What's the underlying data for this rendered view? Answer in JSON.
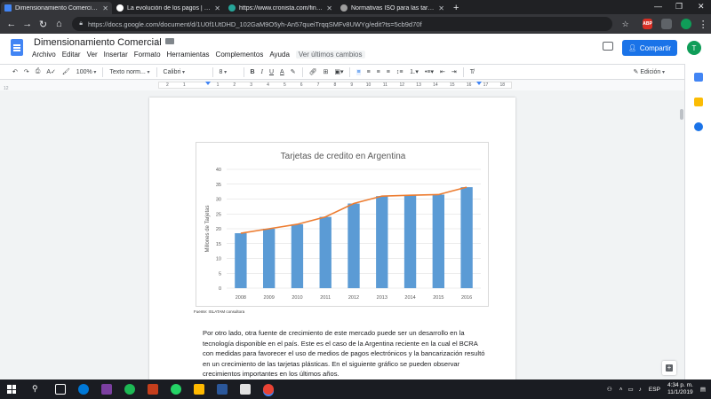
{
  "browser": {
    "tabs": [
      {
        "title": "Dimensionamiento Comercial - G",
        "favicon_color": "#4285f4",
        "active": true
      },
      {
        "title": "La evolución de los pagos | Com",
        "favicon_color": "#ffffff",
        "active": false
      },
      {
        "title": "https://www.cronista.com/finan",
        "favicon_color": "#26a69a",
        "active": false
      },
      {
        "title": "Normativas ISO para las tarjetas",
        "favicon_color": "#9e9e9e",
        "active": false
      }
    ],
    "new_tab": "+",
    "window_controls": {
      "minimize": "—",
      "maximize": "❐",
      "close": "✕"
    },
    "url": "https://docs.google.com/document/d/1U0f1UtDHD_102GaM9O5yh-An57queiTrqqSMFv8UWYg/edit?ts=5cb9d70f"
  },
  "docs": {
    "title": "Dimensionamiento Comercial",
    "menu": [
      "Archivo",
      "Editar",
      "Ver",
      "Insertar",
      "Formato",
      "Herramientas",
      "Complementos",
      "Ayuda"
    ],
    "last_edit": "Ver últimos cambios",
    "share_label": "Compartir",
    "avatar_letter": "T",
    "accent": "#1a73e8"
  },
  "toolbar": {
    "zoom": "100%",
    "style": "Texto norm...",
    "font": "Calibri",
    "size": "8",
    "bold": "B",
    "italic": "I",
    "underline": "U",
    "text_color": "A",
    "mode": "Edición"
  },
  "ruler": {
    "numbers": [
      "2",
      "1",
      "",
      "1",
      "2",
      "3",
      "4",
      "5",
      "6",
      "7",
      "8",
      "9",
      "10",
      "11",
      "12",
      "13",
      "14",
      "15",
      "16",
      "17",
      "18"
    ]
  },
  "gutter_label": "12",
  "chart_data": {
    "type": "bar",
    "title": "Tarjetas de credito en Argentina",
    "ylabel": "Millones de Tarjetas",
    "xlabel": "",
    "categories": [
      "2008",
      "2009",
      "2010",
      "2011",
      "2012",
      "2013",
      "2014",
      "2015",
      "2016"
    ],
    "values": [
      18.5,
      20,
      21.5,
      24,
      28.5,
      31,
      31.3,
      31.5,
      34
    ],
    "line_values": [
      18.5,
      20,
      21.5,
      24,
      28.5,
      31,
      31.3,
      31.5,
      34
    ],
    "ylim": [
      0,
      40
    ],
    "yticks": [
      0,
      5,
      10,
      15,
      20,
      25,
      30,
      35,
      40
    ],
    "grid": true,
    "bar_color": "#5b9bd5",
    "line_color": "#ed7d31"
  },
  "source_note": "Fuente: ISLATAM consultora",
  "body_text": "Por otro lado, otra fuente de crecimiento de este mercado puede ser un desarrollo en la tecnología disponible en el país. Este es el caso de la Argentina reciente en la cual el BCRA con medidas para favorecer el uso de medios de pagos electrónicos y la bancarización resultó en un crecimiento de las tarjetas plásticas. En el siguiente gráfico se pueden observar crecimientos importantes en los últimos años.",
  "taskbar": {
    "lang": "ESP",
    "time": "4:34 p. m.",
    "date": "11/1/2019"
  }
}
